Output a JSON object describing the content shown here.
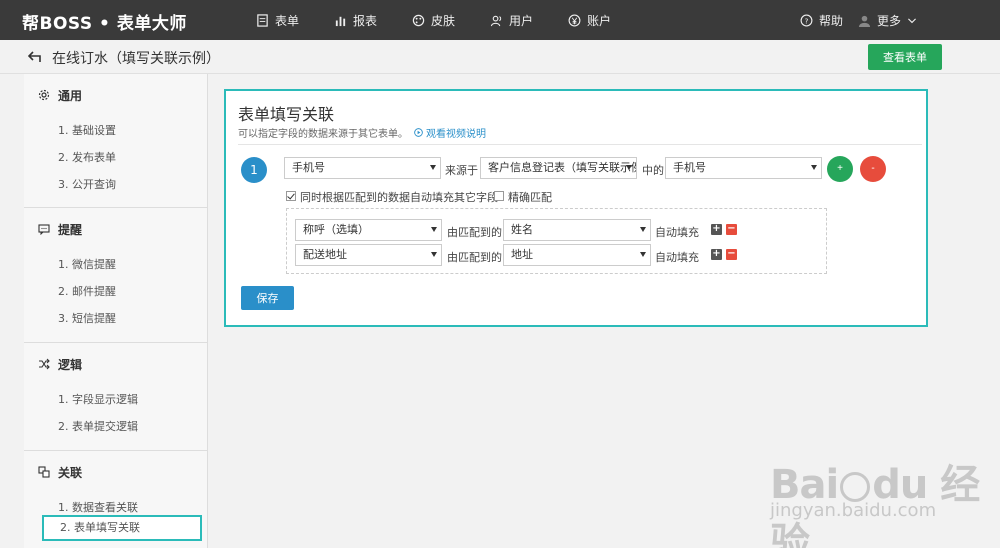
{
  "app": {
    "logo": "帮BOSS • 表单大师"
  },
  "nav": [
    {
      "label": "表单",
      "icon": "form-icon"
    },
    {
      "label": "报表",
      "icon": "bar-chart-icon"
    },
    {
      "label": "皮肤",
      "icon": "palette-icon"
    },
    {
      "label": "用户",
      "icon": "users-icon"
    },
    {
      "label": "账户",
      "icon": "yen-icon"
    }
  ],
  "nav_right": {
    "help": "帮助",
    "more": "更多"
  },
  "titlebar": {
    "title": "在线订水（填写关联示例）",
    "view_button": "查看表单"
  },
  "sidebar": {
    "groups": [
      {
        "title": "通用",
        "icon": "gear-icon",
        "items": [
          "1. 基础设置",
          "2. 发布表单",
          "3. 公开查询"
        ]
      },
      {
        "title": "提醒",
        "icon": "message-icon",
        "items": [
          "1. 微信提醒",
          "2. 邮件提醒",
          "3. 短信提醒"
        ]
      },
      {
        "title": "逻辑",
        "icon": "shuffle-icon",
        "items": [
          "1. 字段显示逻辑",
          "2. 表单提交逻辑"
        ]
      },
      {
        "title": "关联",
        "icon": "link-icon",
        "items": [
          "1. 数据查看关联",
          "2. 表单填写关联"
        ]
      }
    ],
    "active_item": "2. 表单填写关联"
  },
  "panel": {
    "title": "表单填写关联",
    "description": "可以指定字段的数据来源于其它表单。",
    "video_link": "观看视频说明",
    "rule": {
      "number": "1",
      "field": "手机号",
      "source_label": "来源于",
      "source_form": "客户信息登记表（填写关联示例",
      "in_label": "中的",
      "source_field": "手机号",
      "add": "+",
      "remove": "-"
    },
    "auto_fill_checkbox": {
      "label": "同时根据匹配到的数据自动填充其它字段",
      "checked": true
    },
    "exact_match_checkbox": {
      "label": "精确匹配",
      "checked": false
    },
    "mappings": [
      {
        "target": "称呼（选填）",
        "match_label": "由匹配到的",
        "source": "姓名",
        "fill_label": "自动填充"
      },
      {
        "target": "配送地址",
        "match_label": "由匹配到的",
        "source": "地址",
        "fill_label": "自动填充"
      }
    ],
    "save_button": "保存"
  },
  "watermark": {
    "logo": "Bai du 经验",
    "url": "jingyan.baidu.com"
  },
  "colors": {
    "topbar": "#3a3a3a",
    "accent_teal": "#2bbbb9",
    "primary_blue": "#2a8fc9",
    "green": "#26a65b",
    "red": "#e74c3c"
  }
}
